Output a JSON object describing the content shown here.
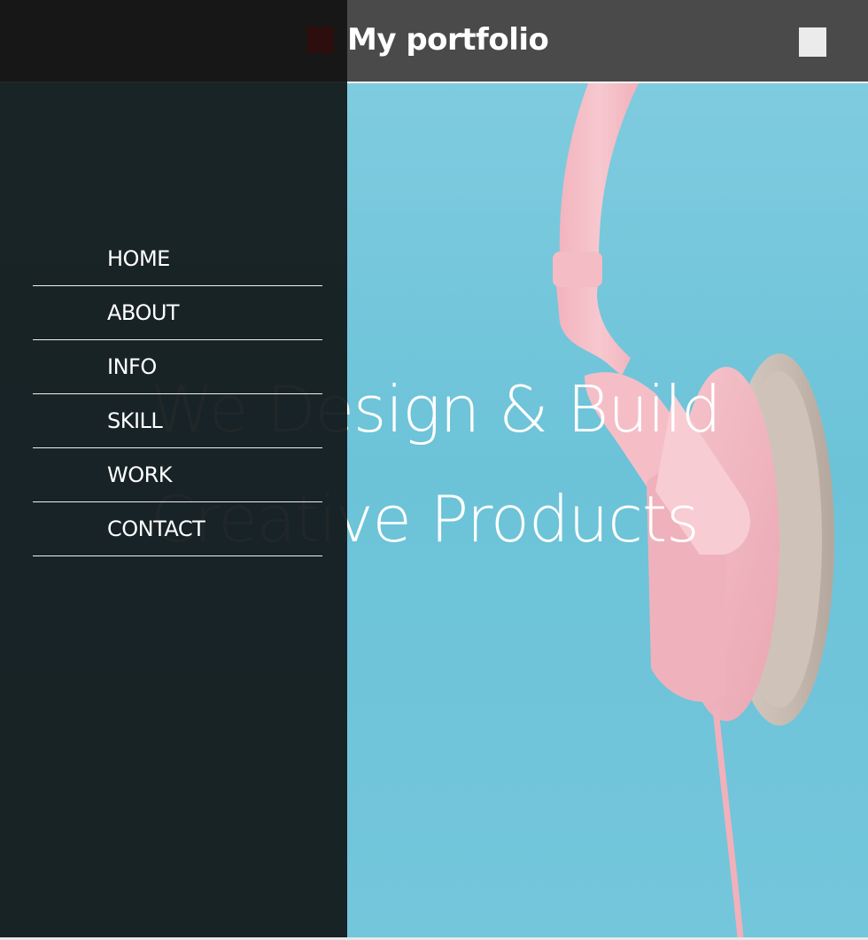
{
  "header": {
    "title": "My portfolio",
    "brand_color": "#ff0000",
    "menu_icon": "menu-toggle-icon"
  },
  "nav": {
    "items": [
      {
        "label": "HOME"
      },
      {
        "label": "ABOUT"
      },
      {
        "label": "INFO"
      },
      {
        "label": "SKILL"
      },
      {
        "label": "WORK"
      },
      {
        "label": "CONTACT"
      }
    ]
  },
  "hero": {
    "line1": "We Design & Build",
    "line2": "Creative Products",
    "background_color": "#74c6db",
    "image_subject": "pink headphones"
  }
}
